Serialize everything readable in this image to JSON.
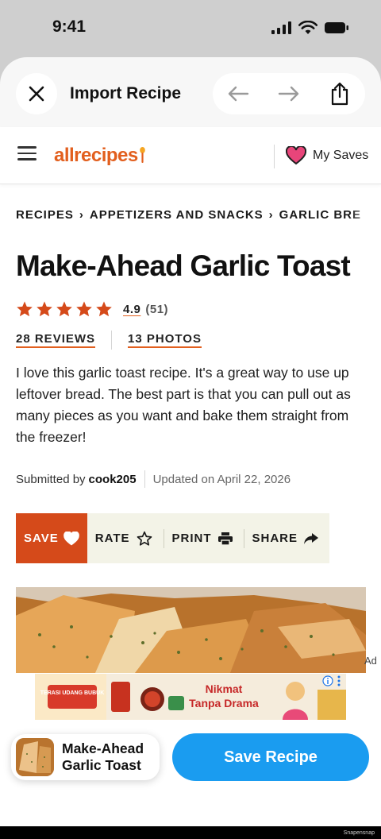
{
  "status_bar": {
    "time": "9:41"
  },
  "browser": {
    "title": "Import Recipe",
    "icons": [
      "close-icon",
      "back-arrow-icon",
      "forward-arrow-icon",
      "share-icon"
    ]
  },
  "site_header": {
    "logo": "allrecipes",
    "my_saves": "My Saves",
    "brand_color": "#e25f1e"
  },
  "breadcrumb": [
    "RECIPES",
    "APPETIZERS AND SNACKS",
    "GARLIC BRE"
  ],
  "recipe": {
    "title": "Make-Ahead Garlic Toast",
    "rating": "4.9",
    "rating_count": "(51)",
    "stars": 5,
    "reviews_link": "28 REVIEWS",
    "photos_link": "13 PHOTOS",
    "description": "I love this garlic toast recipe. It's a great way to use up leftover bread. The best part is that you can pull out as many pieces as you want and bake them straight from the freezer!",
    "submitted_prefix": "Submitted by",
    "author": "cook205",
    "updated": "Updated on April 22, 2026"
  },
  "actions": {
    "save": "SAVE",
    "rate": "RATE",
    "print": "PRINT",
    "share": "SHARE"
  },
  "ad": {
    "label": "Ad",
    "banner_text_1": "Nikmat",
    "banner_text_2": "Tanpa Drama",
    "product_text": "TERASI UDANG BUBUK"
  },
  "bottom": {
    "card_title_1": "Make-Ahead",
    "card_title_2": "Garlic Toast",
    "save_button": "Save Recipe",
    "accent": "#1a9cf0"
  },
  "watermark": "Snapensnap"
}
